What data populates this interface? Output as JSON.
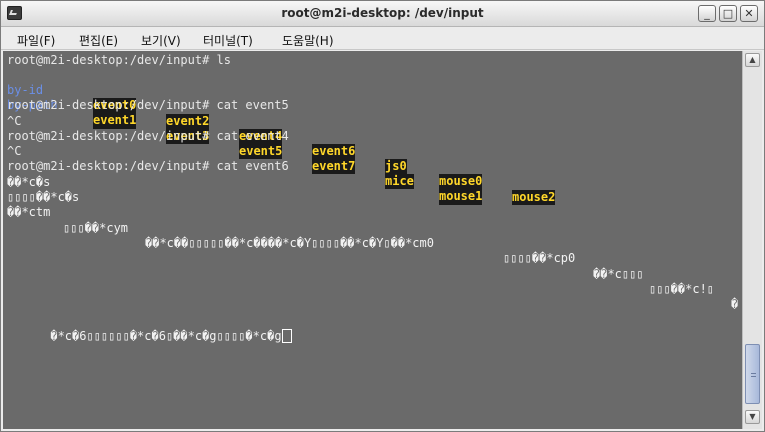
{
  "window": {
    "title": "root@m2i-desktop: /dev/input",
    "minimize_label": "_",
    "maximize_label": "□",
    "close_label": "✕"
  },
  "menu": [
    "파일(F)",
    "편집(E)",
    "보기(V)",
    "터미널(T)",
    "도움말(H)"
  ],
  "terminal": {
    "prompt": "root@m2i-desktop:/dev/input#",
    "ls_cmd": "root@m2i-desktop:/dev/input# ls",
    "ls_row1": {
      "dir": "by-id",
      "files": [
        "event0",
        "event2",
        "event4",
        "event6",
        "js0",
        "mouse0",
        "mouse2"
      ]
    },
    "ls_row2": {
      "dir": "by-path",
      "files": [
        "event1",
        "event3",
        "event5",
        "event7",
        "mice",
        "mouse1"
      ]
    },
    "cmd_event5": "root@m2i-desktop:/dev/input# cat event5",
    "ctrl_c_1": "^C",
    "cmd_event4": "root@m2i-desktop:/dev/input# cat event4",
    "ctrl_c_2": "^C",
    "cmd_event6": "root@m2i-desktop:/dev/input# cat event6",
    "garbage": [
      "��*c�s",
      "▯▯▯▯��*c�s",
      "��*ctm",
      "▯▯▯��*cym",
      "��*c��▯▯▯▯▯��*c����*c�Y▯▯▯▯��*c�Y▯��*cm0",
      "▯▯▯▯��*cp0",
      "��*c▯▯▯",
      "▯▯▯��*c!▯",
      "�",
      "�*c�6▯▯▯▯▯▯�*c�6▯��*c�g▯▯▯▯�*c�g"
    ]
  },
  "scrollbar": {
    "up": "▲",
    "down": "▼"
  }
}
